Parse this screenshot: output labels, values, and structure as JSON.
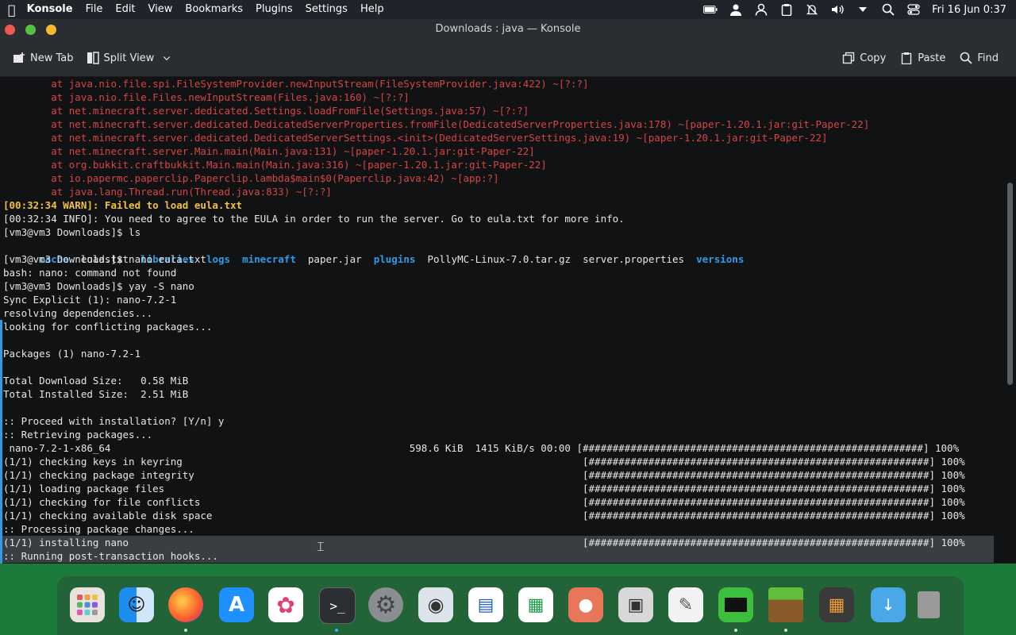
{
  "menubar": {
    "app_name": "Konsole",
    "menus": [
      "File",
      "Edit",
      "View",
      "Bookmarks",
      "Plugins",
      "Settings",
      "Help"
    ],
    "clock": "Fri 16 Jun 0:37"
  },
  "window": {
    "title": "Downloads : java — Konsole"
  },
  "toolbar": {
    "new_tab": "New Tab",
    "split_view": "Split View",
    "copy": "Copy",
    "paste": "Paste",
    "find": "Find"
  },
  "terminal": {
    "lines": [
      "        at java.nio.file.spi.FileSystemProvider.newInputStream(FileSystemProvider.java:422) ~[?:?]",
      "        at java.nio.file.Files.newInputStream(Files.java:160) ~[?:?]",
      "        at net.minecraft.server.dedicated.Settings.loadFromFile(Settings.java:57) ~[?:?]",
      "        at net.minecraft.server.dedicated.DedicatedServerProperties.fromFile(DedicatedServerProperties.java:178) ~[paper-1.20.1.jar:git-Paper-22]",
      "        at net.minecraft.server.dedicated.DedicatedServerSettings.<init>(DedicatedServerSettings.java:19) ~[paper-1.20.1.jar:git-Paper-22]",
      "        at net.minecraft.server.Main.main(Main.java:131) ~[paper-1.20.1.jar:git-Paper-22]",
      "        at org.bukkit.craftbukkit.Main.main(Main.java:316) ~[paper-1.20.1.jar:git-Paper-22]",
      "        at io.papermc.paperclip.Paperclip.lambda$main$0(Paperclip.java:42) ~[app:?]",
      "        at java.lang.Thread.run(Thread.java:833) ~[?:?]",
      "[00:32:34 WARN]: Failed to load eula.txt",
      "[00:32:34 INFO]: You need to agree to the EULA in order to run the server. Go to eula.txt for more info.",
      "[vm3@vm3 Downloads]$ ls",
      "",
      "[vm3@vm3 Downloads]$ nano eula.txt",
      "bash: nano: command not found",
      "[vm3@vm3 Downloads]$ yay -S nano",
      "Sync Explicit (1): nano-7.2-1",
      "resolving dependencies...",
      "looking for conflicting packages...",
      "",
      "Packages (1) nano-7.2-1",
      "",
      "Total Download Size:   0.58 MiB",
      "Total Installed Size:  2.51 MiB",
      "",
      ":: Proceed with installation? [Y/n] y",
      ":: Retrieving packages...",
      " nano-7.2-1-x86_64                                                  598.6 KiB  1415 KiB/s 00:00 [#########################################################] 100%",
      "(1/1) checking keys in keyring                                                                   [#########################################################] 100%",
      "(1/1) checking package integrity                                                                 [#########################################################] 100%",
      "(1/1) loading package files                                                                      [#########################################################] 100%",
      "(1/1) checking for file conflicts                                                                [#########################################################] 100%",
      "(1/1) checking available disk space                                                              [#########################################################] 100%",
      ":: Processing package changes...",
      "(1/1) installing nano                                                                            [#########################################################] 100%",
      ":: Running post-transaction hooks..."
    ],
    "ls_output": [
      {
        "name": "cache",
        "kind": "dir"
      },
      {
        "name": "eula.txt",
        "kind": "file"
      },
      {
        "name": "libraries",
        "kind": "dir"
      },
      {
        "name": "logs",
        "kind": "dir"
      },
      {
        "name": "minecraft",
        "kind": "dir"
      },
      {
        "name": "paper.jar",
        "kind": "file"
      },
      {
        "name": "plugins",
        "kind": "dir"
      },
      {
        "name": "PollyMC-Linux-7.0.tar.gz",
        "kind": "file"
      },
      {
        "name": "server.properties",
        "kind": "file"
      },
      {
        "name": "versions",
        "kind": "dir"
      }
    ]
  },
  "dock": {
    "apps": [
      "launchpad-icon",
      "finder-icon",
      "firefox-icon",
      "app-store-icon",
      "photos-icon",
      "terminal-icon",
      "system-settings-icon",
      "screenshot-icon",
      "text-editor-icon",
      "spreadsheet-icon",
      "image-viewer-icon",
      "media-player-icon",
      "notes-icon",
      "game-icon",
      "minecraft-icon",
      "calculator-icon",
      "downloads-folder-icon",
      "trash-icon"
    ]
  },
  "colors": {
    "error_text": "#d64545",
    "warn_text": "#f0c040",
    "dir_text": "#2f9be6"
  }
}
